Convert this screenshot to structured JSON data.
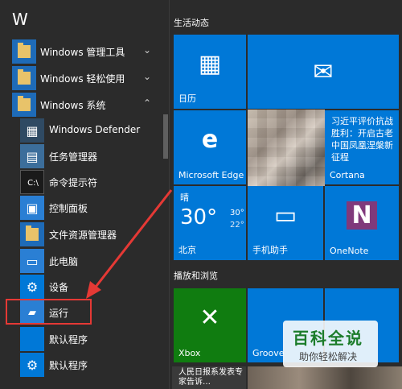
{
  "left": {
    "letter": "W",
    "items": [
      {
        "label": "Windows 管理工具",
        "chevron": "⌄",
        "icon": "folder-icon"
      },
      {
        "label": "Windows 轻松使用",
        "chevron": "⌄",
        "icon": "folder-icon"
      },
      {
        "label": "Windows 系统",
        "chevron": "⌃",
        "icon": "folder-icon"
      },
      {
        "label": "Windows Defender",
        "icon": "defender-icon"
      },
      {
        "label": "任务管理器",
        "icon": "task-manager-icon"
      },
      {
        "label": "命令提示符",
        "icon": "cmd-icon"
      },
      {
        "label": "控制面板",
        "icon": "control-panel-icon"
      },
      {
        "label": "文件资源管理器",
        "icon": "file-explorer-icon"
      },
      {
        "label": "此电脑",
        "icon": "this-pc-icon"
      },
      {
        "label": "设备",
        "icon": "gear-icon"
      },
      {
        "label": "运行",
        "icon": "run-icon"
      },
      {
        "label": "默认程序",
        "icon": "default-programs-icon"
      },
      {
        "label": "默认程序",
        "icon": "gear-icon"
      }
    ],
    "annotation_color": "#e53935"
  },
  "right": {
    "section1": "生活动态",
    "section2": "播放和浏览",
    "tiles": {
      "calendar": "日历",
      "mail": "",
      "news": "习近平评价抗战胜利：开启古老中国凤凰涅槃新征程",
      "edge": "Microsoft Edge",
      "cortana": "Cortana",
      "weather_condition": "晴",
      "weather_temp": "30°",
      "weather_hi": "30°",
      "weather_lo": "22°",
      "weather_city": "北京",
      "phone": "手机助手",
      "onenote": "OneNote",
      "xbox": "Xbox",
      "groove": "Groove",
      "news2": "人民日报系发表专家告诉…"
    }
  },
  "watermark": {
    "title": "百科全说",
    "subtitle": "助你轻松解决"
  },
  "colors": {
    "tile": "#0078d7",
    "background": "#2b2b2b",
    "annotation": "#e53935",
    "xbox": "#107c10",
    "onenote": "#80397b"
  }
}
